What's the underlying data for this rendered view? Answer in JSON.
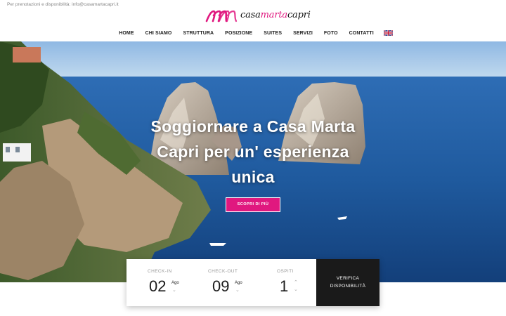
{
  "topbar": {
    "contact_text": "Per prenotazioni e disponibilità: info@casamartacapri.it"
  },
  "logo": {
    "part1": "casa",
    "part2": "marta",
    "part3": "capri"
  },
  "nav": {
    "items": [
      "HOME",
      "CHI SIAMO",
      "STRUTTURA",
      "POSIZIONE",
      "SUITES",
      "SERVIZI",
      "FOTO",
      "CONTATTI"
    ],
    "language_flag": "uk-flag-icon"
  },
  "hero": {
    "title_line1": "Soggiornare a Casa Marta",
    "title_line2": "Capri per un' esperienza",
    "title_line3": "unica",
    "cta_label": "SCOPRI DI PIÙ"
  },
  "booking": {
    "checkin_label": "CHECK-IN",
    "checkin_day": "02",
    "checkin_month": "Ago",
    "checkout_label": "CHECK-OUT",
    "checkout_day": "09",
    "checkout_month": "Ago",
    "guests_label": "OSPITI",
    "guests_value": "1",
    "verify_line1": "VERIFICA",
    "verify_line2": "DISPONIBILITÀ"
  },
  "colors": {
    "accent": "#e0187f",
    "dark": "#1a1a1a",
    "sea": "#1f5a9e"
  }
}
